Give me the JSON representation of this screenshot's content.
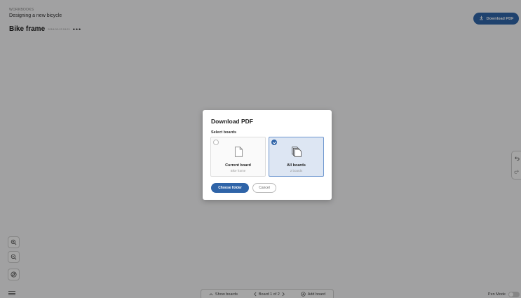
{
  "header": {
    "breadcrumb": "WORKBOOKS",
    "project_name": "Designing a new bicycle",
    "board_title": "Bike frame",
    "board_date": "2018-02-13 19:21",
    "more_label": "•••",
    "download_button": "Download PDF"
  },
  "bottom_bar": {
    "show_boards": "Show boards",
    "board_position": "Board 1 of 2",
    "add_board": "Add board",
    "pen_mode": "Pen Mode"
  },
  "dialog": {
    "title": "Download PDF",
    "select_label": "Select boards",
    "options": [
      {
        "name": "Current board",
        "sub": "Bike frame",
        "selected": false
      },
      {
        "name": "All boards",
        "sub": "2 boards",
        "selected": true
      }
    ],
    "choose_button": "Choose folder",
    "cancel_button": "Cancel"
  },
  "colors": {
    "accent": "#2f64a8",
    "selected_bg": "#dde6f3"
  },
  "icons": [
    "download-icon",
    "zoom-in-icon",
    "zoom-out-icon",
    "compass-icon",
    "undo-icon",
    "redo-icon",
    "menu-icon",
    "chevron-up-icon",
    "chevron-left-icon",
    "chevron-right-icon",
    "add-icon",
    "page-icon",
    "pages-stack-icon"
  ]
}
